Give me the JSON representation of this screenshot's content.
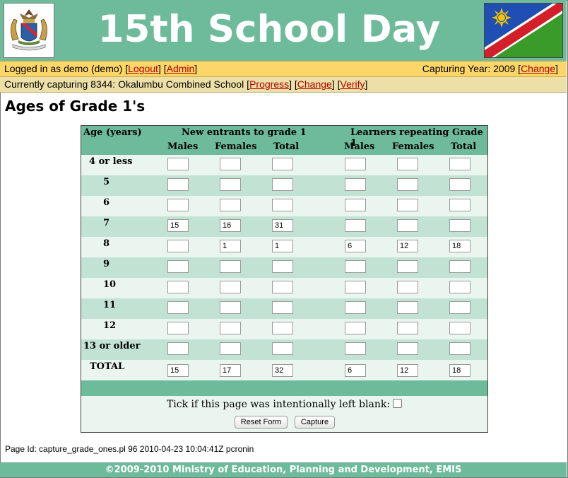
{
  "header": {
    "title": "15th School Day",
    "logo_icon": "namibia-coat-of-arms-icon",
    "flag_icon": "namibia-flag-icon",
    "brand_color": "#6dbb9b"
  },
  "login_bar": {
    "logged_in_text": "Logged in as demo (demo)",
    "logout_label": "Logout",
    "admin_label": "Admin",
    "capturing_year_text": "Capturing Year: 2009",
    "change_label": "Change"
  },
  "capture_bar": {
    "school_text": "Currently capturing 8344: Okalumbu Combined School",
    "progress_label": "Progress",
    "change_label": "Change",
    "verify_label": "Verify"
  },
  "page_title": "Ages of Grade 1's",
  "form": {
    "age_header": "Age (years)",
    "new_entrants_header": "New entrants to grade 1",
    "repeaters_header": "Learners repeating Grade 1",
    "col_males": "Males",
    "col_females": "Females",
    "col_total": "Total",
    "rows": [
      {
        "label": "4 or less",
        "values": [
          "",
          "",
          "",
          "",
          "",
          ""
        ]
      },
      {
        "label": "5",
        "values": [
          "",
          "",
          "",
          "",
          "",
          ""
        ]
      },
      {
        "label": "6",
        "values": [
          "",
          "",
          "",
          "",
          "",
          ""
        ]
      },
      {
        "label": "7",
        "values": [
          "15",
          "16",
          "31",
          "",
          "",
          ""
        ]
      },
      {
        "label": "8",
        "values": [
          "",
          "1",
          "1",
          "6",
          "12",
          "18"
        ]
      },
      {
        "label": "9",
        "values": [
          "",
          "",
          "",
          "",
          "",
          ""
        ]
      },
      {
        "label": "10",
        "values": [
          "",
          "",
          "",
          "",
          "",
          ""
        ]
      },
      {
        "label": "11",
        "values": [
          "",
          "",
          "",
          "",
          "",
          ""
        ]
      },
      {
        "label": "12",
        "values": [
          "",
          "",
          "",
          "",
          "",
          ""
        ]
      },
      {
        "label": "13 or older",
        "values": [
          "",
          "",
          "",
          "",
          "",
          ""
        ]
      },
      {
        "label": "TOTAL",
        "values": [
          "15",
          "17",
          "32",
          "6",
          "12",
          "18"
        ]
      }
    ],
    "blank_text": "Tick if this page was intentionally left blank:",
    "reset_label": "Reset Form",
    "capture_label": "Capture"
  },
  "page_id_text": "Page Id: capture_grade_ones.pl 96 2010-04-23 10:04:41Z pcronin",
  "footer_text": "©2009-2010 Ministry of Education, Planning and Development, EMIS"
}
